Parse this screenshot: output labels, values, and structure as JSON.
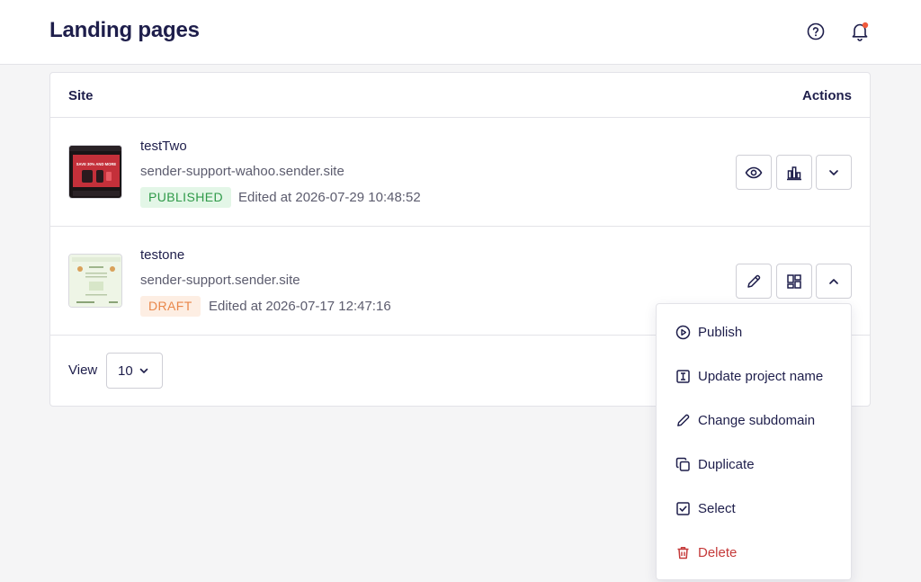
{
  "header": {
    "title": "Landing pages",
    "help_icon": "help-circle-icon",
    "bell_icon": "bell-icon"
  },
  "colors": {
    "text_primary": "#1e1e4b",
    "text_secondary": "#5c5c6e",
    "published_bg": "#e3f6e7",
    "published_fg": "#2f9a49",
    "draft_bg": "#fdeee3",
    "draft_fg": "#e9874a",
    "danger": "#c53a3a",
    "notification_dot": "#f05a3c"
  },
  "table": {
    "columns": [
      "Site",
      "Actions"
    ],
    "rows": [
      {
        "name": "testTwo",
        "domain": "sender-support-wahoo.sender.site",
        "status": "PUBLISHED",
        "edited": "Edited at 2026-07-29 10:48:52",
        "thumb_text": "SAVE 30% AND MORE",
        "actions": [
          "eye-icon",
          "bar-chart-icon",
          "chevron-down-icon"
        ]
      },
      {
        "name": "testone",
        "domain": "sender-support.sender.site",
        "status": "DRAFT",
        "edited": "Edited at 2026-07-17 12:47:16",
        "actions": [
          "pencil-icon",
          "grid-icon",
          "chevron-up-icon"
        ]
      }
    ]
  },
  "footer": {
    "view_label": "View",
    "page_size": "10"
  },
  "dropdown_menu": {
    "items": [
      {
        "label": "Publish",
        "icon": "play-circle-icon"
      },
      {
        "label": "Update project name",
        "icon": "text-cursor-icon"
      },
      {
        "label": "Change subdomain",
        "icon": "pencil-icon"
      },
      {
        "label": "Duplicate",
        "icon": "copy-icon"
      },
      {
        "label": "Select",
        "icon": "checkbox-icon"
      },
      {
        "label": "Delete",
        "icon": "trash-icon"
      }
    ]
  }
}
